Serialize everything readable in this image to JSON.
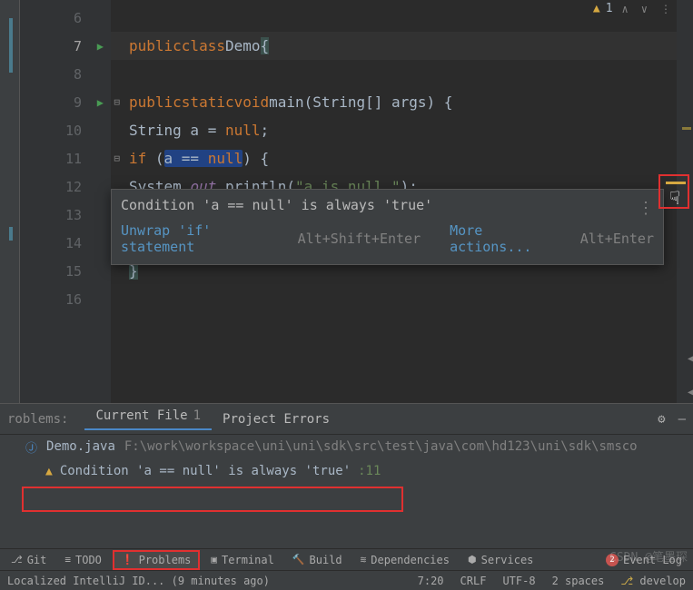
{
  "editor": {
    "warn_count": "1",
    "lines": [
      {
        "n": "6"
      },
      {
        "n": "7",
        "run": true
      },
      {
        "n": "8"
      },
      {
        "n": "9",
        "run": true,
        "fold": true
      },
      {
        "n": "10"
      },
      {
        "n": "11",
        "fold": true
      },
      {
        "n": "12"
      },
      {
        "n": "13"
      },
      {
        "n": "14"
      },
      {
        "n": "15"
      },
      {
        "n": "16"
      }
    ],
    "code": {
      "l7_public": "public",
      "l7_class": "class",
      "l7_demo": "Demo",
      "l7_brace": "{",
      "l9_public": "public",
      "l9_static": "static",
      "l9_void": "void",
      "l9_main": "main(String[] args) {",
      "l10_str": "String a = ",
      "l10_null": "null",
      "l10_semi": ";",
      "l11_if": "if",
      "l11_paren": " (",
      "l11_cond": "a == ",
      "l11_null": "null",
      "l11_close": ") {",
      "l12_sys": "System.",
      "l12_out": "out",
      "l12_print": ".println(",
      "l12_msg": "\"a is null.\"",
      "l12_end": ");",
      "l15_brace": "}"
    }
  },
  "hint": {
    "message": "Condition 'a == null' is always 'true'",
    "action_unwrap": "Unwrap 'if' statement",
    "shortcut_unwrap": "Alt+Shift+Enter",
    "action_more": "More actions...",
    "shortcut_more": "Alt+Enter"
  },
  "problems": {
    "title": "roblems:",
    "tab_current": "Current File",
    "tab_current_count": "1",
    "tab_project": "Project Errors",
    "file_name": "Demo.java",
    "file_path": "F:\\work\\workspace\\uni\\uni\\sdk\\src\\test\\java\\com\\hd123\\uni\\sdk\\smsco",
    "entry_msg": "Condition 'a == null' is always 'true'",
    "entry_line": ":11"
  },
  "bottom_tabs": {
    "git": "Git",
    "todo": "TODO",
    "problems": "Problems",
    "terminal": "Terminal",
    "build": "Build",
    "dependencies": "Dependencies",
    "services": "Services",
    "event_count": "2",
    "event_log": "Event Log"
  },
  "status": {
    "localized": "Localized IntelliJ ID... (9 minutes ago)",
    "pos": "7:20",
    "crlf": "CRLF",
    "enc": "UTF-8",
    "indent": "2 spaces",
    "branch": "develop"
  },
  "watermark": "CSDN @笔墨琛"
}
